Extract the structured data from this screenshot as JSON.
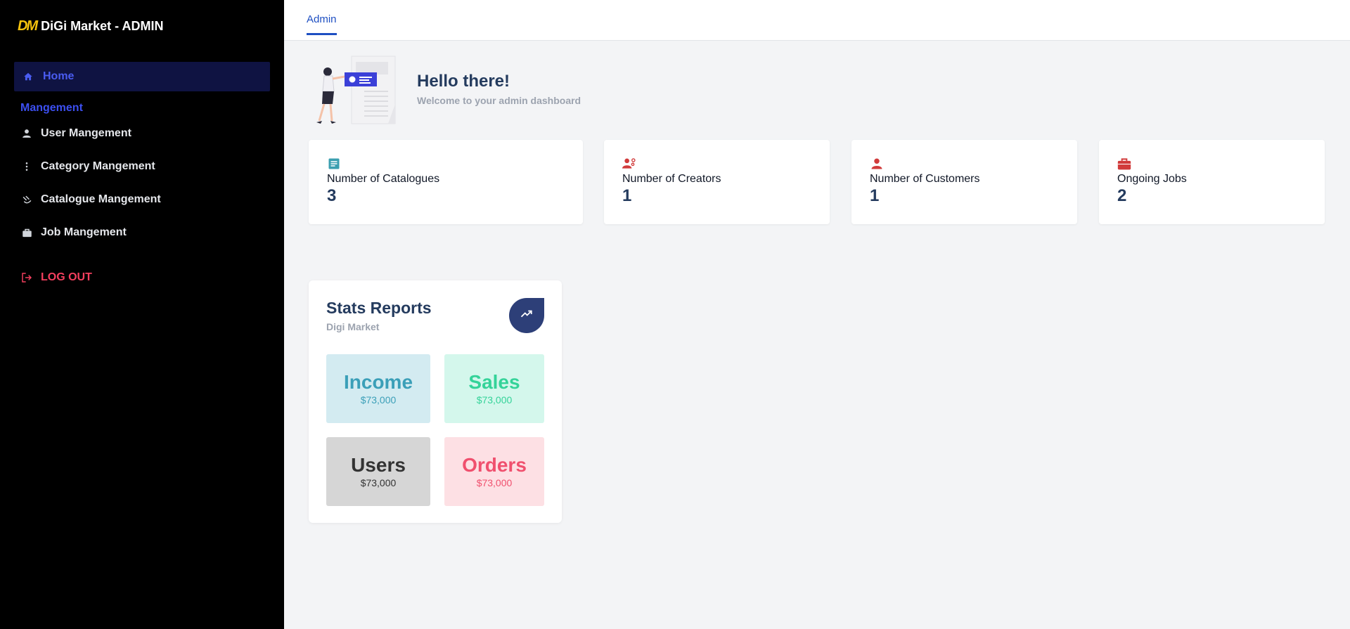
{
  "brand": {
    "logo": "DM",
    "title": "DiGi Market - ADMIN"
  },
  "sidebar": {
    "home": {
      "label": "Home",
      "icon": "home-icon"
    },
    "section_label": "Mangement",
    "items": [
      {
        "label": "User Mangement",
        "icon": "user-icon"
      },
      {
        "label": "Category Mangement",
        "icon": "dots-vertical-icon"
      },
      {
        "label": "Catalogue Mangement",
        "icon": "catalogue-icon"
      },
      {
        "label": "Job Mangement",
        "icon": "briefcase-icon"
      }
    ],
    "logout": {
      "label": "LOG OUT",
      "icon": "logout-icon"
    }
  },
  "topbar": {
    "tab": "Admin"
  },
  "hello": {
    "title": "Hello there!",
    "subtitle": "Welcome to your admin dashboard"
  },
  "cards": [
    {
      "label": "Number of Catalogues",
      "value": "3",
      "icon": "document-icon",
      "color": "#3b9fb0"
    },
    {
      "label": "Number of Creators",
      "value": "1",
      "icon": "creators-icon",
      "color": "#d13b3b"
    },
    {
      "label": "Number of Customers",
      "value": "1",
      "icon": "user-icon",
      "color": "#d13b3b"
    },
    {
      "label": "Ongoing Jobs",
      "value": "2",
      "icon": "briefcase-icon",
      "color": "#d13b3b"
    }
  ],
  "report": {
    "title": "Stats Reports",
    "subtitle": "Digi Market",
    "icon": "trending-up-icon",
    "tiles": [
      {
        "title": "Income",
        "value": "$73,000",
        "bg": "#d3ebf1",
        "color": "#3b9fb8"
      },
      {
        "title": "Sales",
        "value": "$73,000",
        "bg": "#d4f7ec",
        "color": "#34d399"
      },
      {
        "title": "Users",
        "value": "$73,000",
        "bg": "#d6d6d6",
        "color": "#333333"
      },
      {
        "title": "Orders",
        "value": "$73,000",
        "bg": "#fde0e4",
        "color": "#f0506e"
      }
    ]
  }
}
